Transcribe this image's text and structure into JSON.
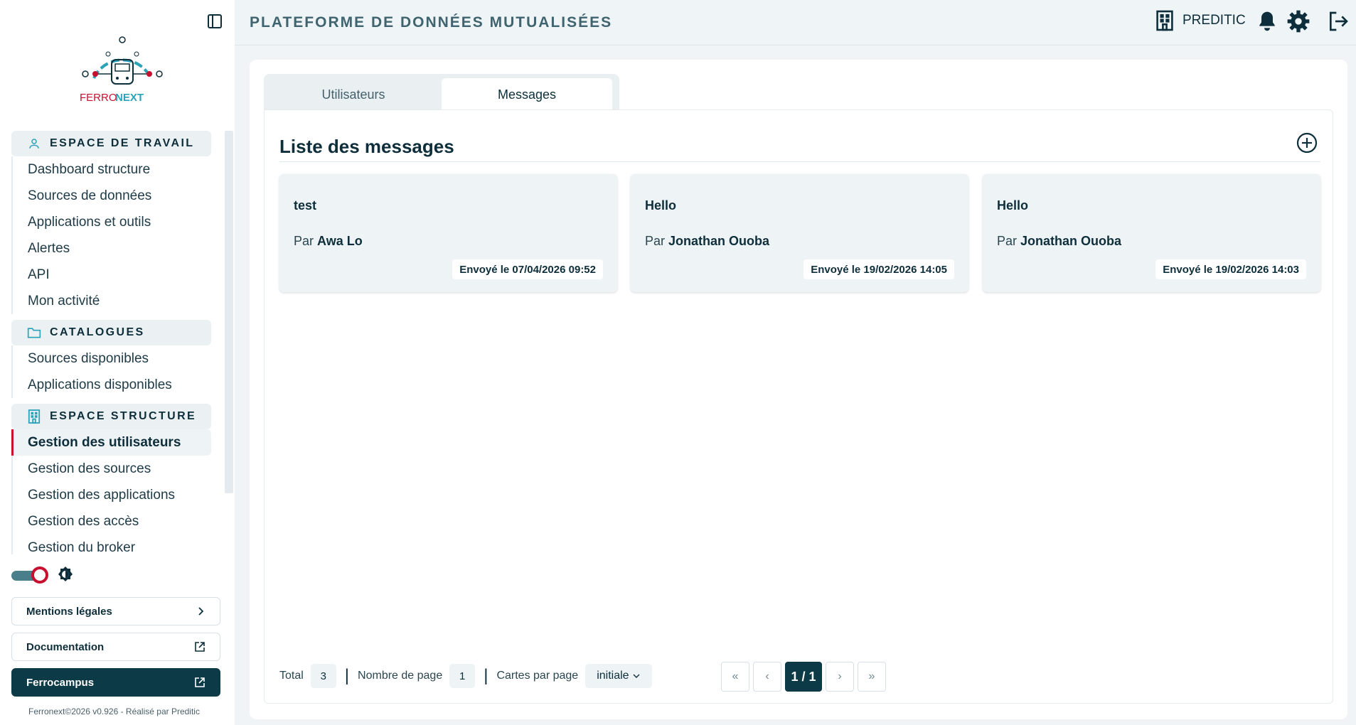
{
  "app": {
    "title": "PLATEFORME DE DONNÉES MUTUALISÉES",
    "organization": "PREDITIC",
    "logo_text_left": "FERRO",
    "logo_text_right": "NEXT"
  },
  "colors": {
    "primary": "#0d3a47",
    "accent": "#c8102e",
    "teal": "#2aa3b8"
  },
  "sidebar": {
    "sections": [
      {
        "label": "ESPACE DE TRAVAIL",
        "icon": "user-icon",
        "items": [
          "Dashboard structure",
          "Sources de données",
          "Applications et outils",
          "Alertes",
          "API",
          "Mon activité"
        ]
      },
      {
        "label": "CATALOGUES",
        "icon": "folder-icon",
        "items": [
          "Sources disponibles",
          "Applications disponibles"
        ]
      },
      {
        "label": "ESPACE STRUCTURE",
        "icon": "building-icon",
        "items": [
          "Gestion des utilisateurs",
          "Gestion des sources",
          "Gestion des applications",
          "Gestion des accès",
          "Gestion du broker"
        ]
      }
    ],
    "active_item": "Gestion des utilisateurs",
    "buttons": {
      "legal": "Mentions légales",
      "docs": "Documentation",
      "campus": "Ferrocampus"
    },
    "footer": "Ferronext©2026 v0.926 - Réalisé par Preditic"
  },
  "tabs": [
    "Utilisateurs",
    "Messages"
  ],
  "active_tab": "Messages",
  "messages": {
    "title": "Liste des messages",
    "by_prefix": "Par",
    "items": [
      {
        "title": "test",
        "author": "Awa Lo",
        "sent": "Envoyé le 07/04/2026 09:52"
      },
      {
        "title": "Hello",
        "author": "Jonathan Ouoba",
        "sent": "Envoyé le 19/02/2026 14:05"
      },
      {
        "title": "Hello",
        "author": "Jonathan Ouoba",
        "sent": "Envoyé le 19/02/2026 14:03"
      }
    ]
  },
  "pagination": {
    "total_label": "Total",
    "total": "3",
    "pages_label": "Nombre de page",
    "pages": "1",
    "per_page_label": "Cartes par page",
    "per_page": "initiale",
    "current": "1 / 1",
    "first": "«",
    "prev": "‹",
    "next": "›",
    "last": "»"
  }
}
